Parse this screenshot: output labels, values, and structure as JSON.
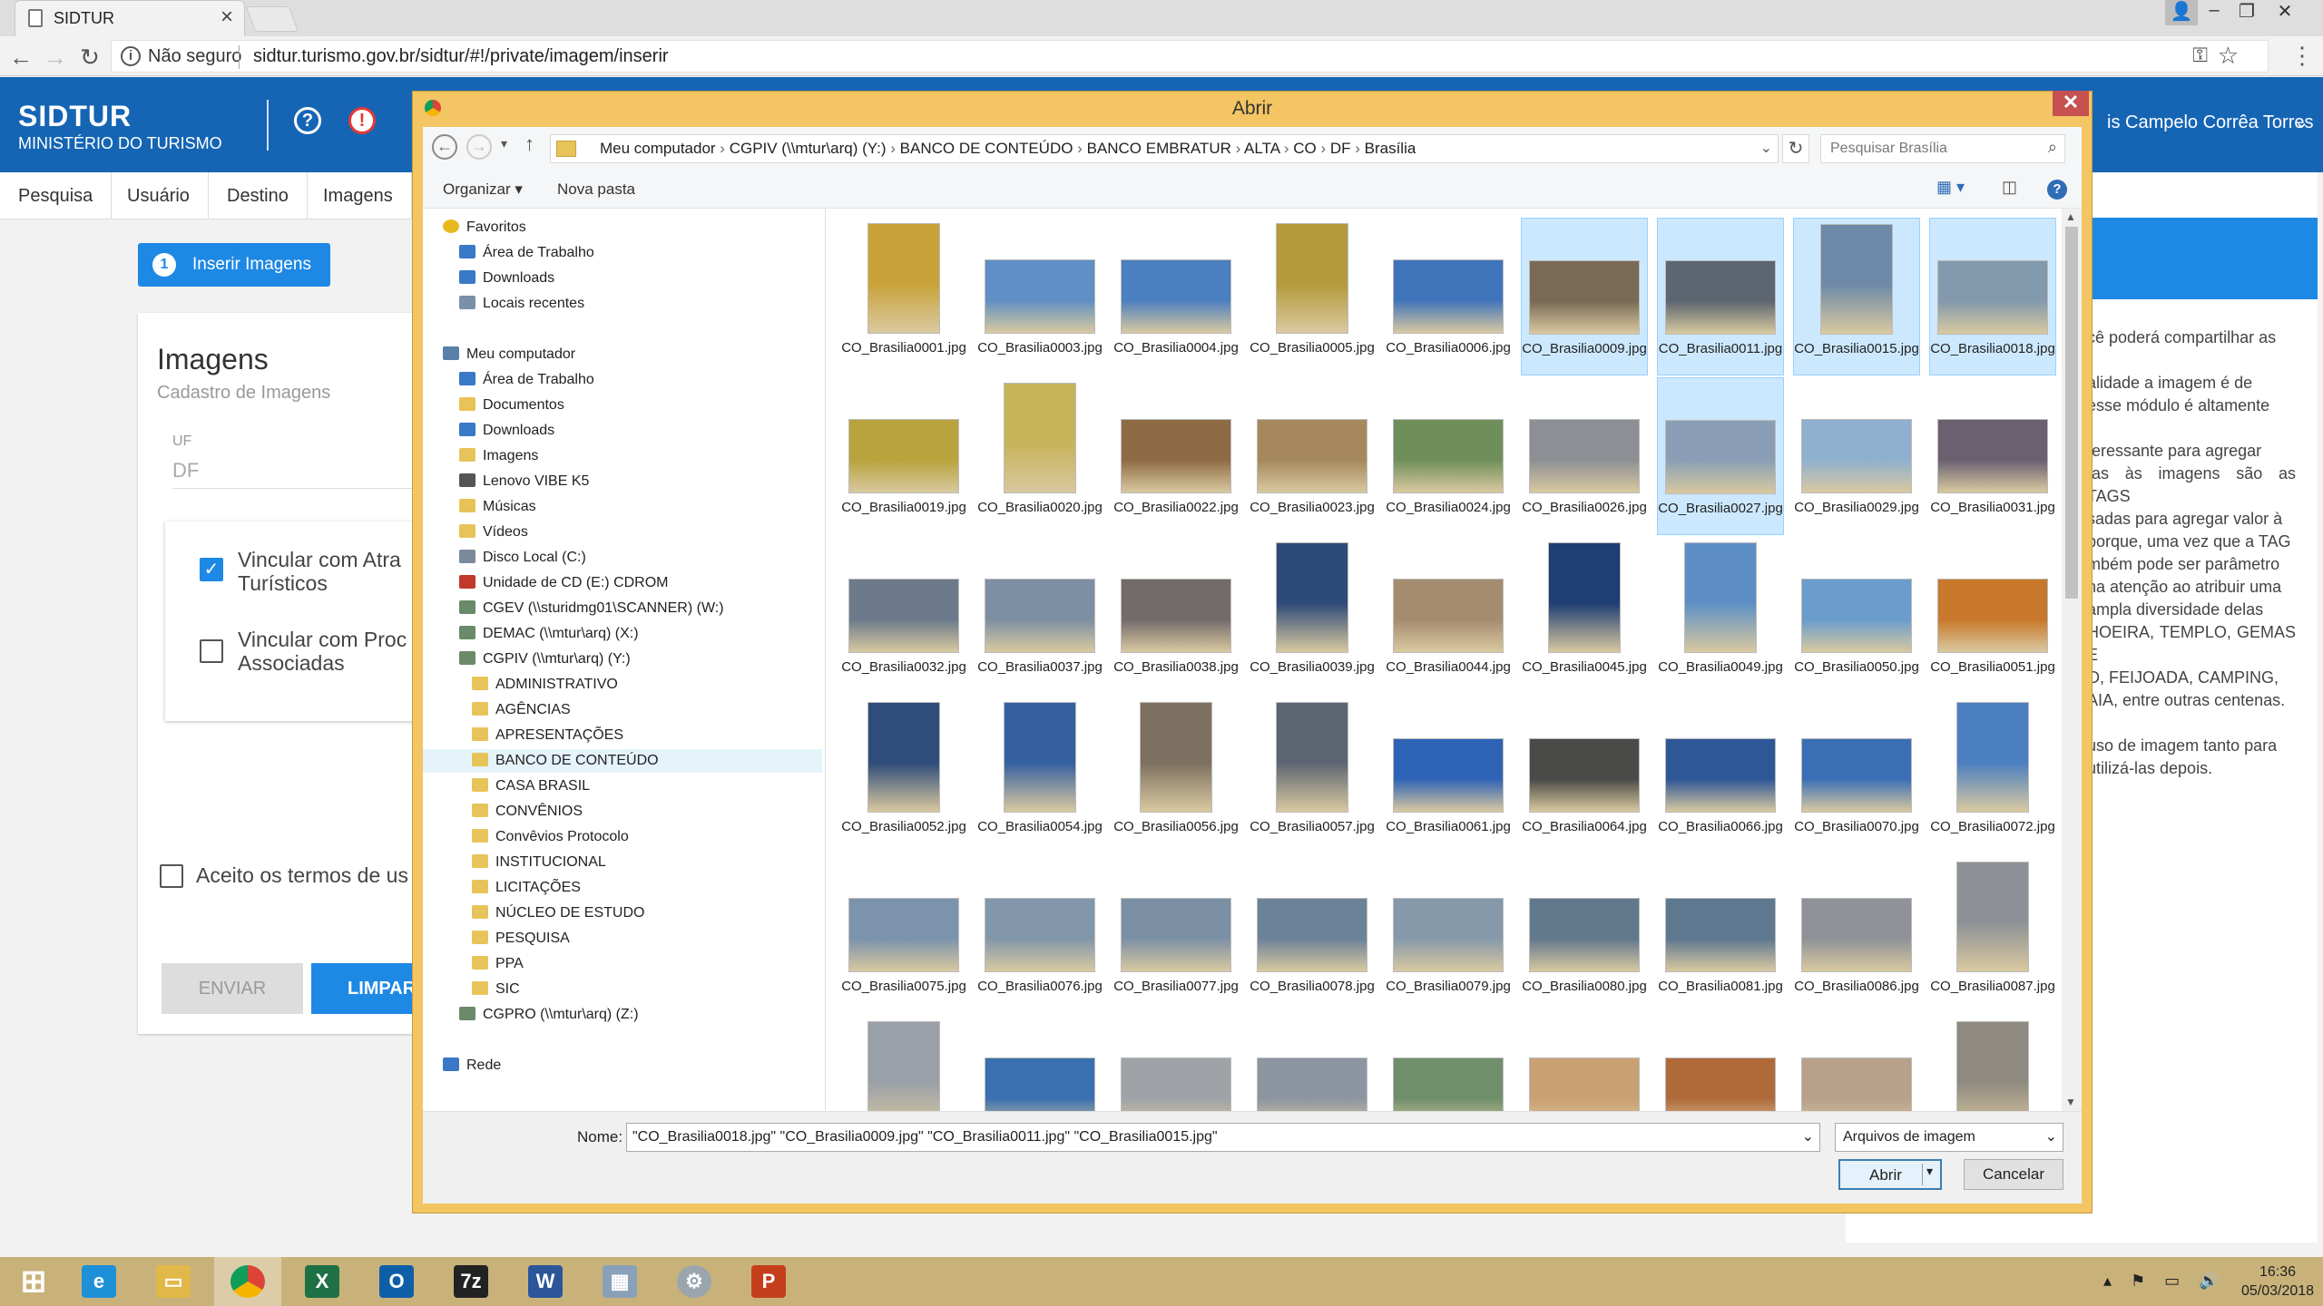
{
  "browser": {
    "tab_title": "SIDTUR",
    "not_secure": "Não seguro",
    "url": "sidtur.turismo.gov.br/sidtur/#!/private/imagem/inserir"
  },
  "app": {
    "brand": "SIDTUR",
    "brand_sub": "MINISTÉRIO DO TURISMO",
    "user_name": "is Campelo Corrêa Torres",
    "nav": [
      "Pesquisa",
      "Usuário",
      "Destino",
      "Imagens"
    ],
    "insert_button": "Inserir Imagens",
    "step": "1",
    "card_title": "Imagens",
    "card_subtitle": "Cadastro de Imagens",
    "uf_label": "UF",
    "uf_value": "DF",
    "check1_line1": "Vincular com Atra",
    "check1_line2": "Turísticos",
    "check2_line1": "Vincular com Proc",
    "check2_line2": "Associadas",
    "terms": "Aceito os termos de us",
    "btn_send": "ENVIAR",
    "btn_clear": "LIMPAR",
    "right_text": [
      "cê poderá compartilhar as",
      "",
      "alidade a imagem é de",
      "esse módulo é altamente",
      "",
      "teressante para agregar",
      "tas às imagens são as TAGS",
      "sadas para agregar valor à",
      "porque, uma vez que a TAG",
      "mbém pode ser parâmetro",
      "ha atenção ao atribuir uma",
      "ampla diversidade delas",
      "HOEIRA, TEMPLO, GEMAS E",
      "O, FEIJOADA, CAMPING,",
      "AIA, entre outras centenas.",
      "",
      "uso de imagem tanto para",
      "utilizá-las depois."
    ]
  },
  "dialog": {
    "title": "Abrir",
    "path": [
      "Meu computador",
      "CGPIV (\\\\mtur\\arq) (Y:)",
      "BANCO DE CONTEÚDO",
      "BANCO EMBRATUR",
      "ALTA",
      "CO",
      "DF",
      "Brasília"
    ],
    "search_placeholder": "Pesquisar Brasília",
    "organize": "Organizar",
    "new_folder": "Nova pasta",
    "tree": [
      {
        "label": "Favoritos",
        "level": 0,
        "icon": "star"
      },
      {
        "label": "Área de Trabalho",
        "level": 1,
        "icon": "desktop"
      },
      {
        "label": "Downloads",
        "level": 1,
        "icon": "download"
      },
      {
        "label": "Locais recentes",
        "level": 1,
        "icon": "recent"
      },
      {
        "label": "",
        "level": -1
      },
      {
        "label": "Meu computador",
        "level": 0,
        "icon": "computer"
      },
      {
        "label": "Área de Trabalho",
        "level": 1,
        "icon": "desktop"
      },
      {
        "label": "Documentos",
        "level": 1,
        "icon": "folder"
      },
      {
        "label": "Downloads",
        "level": 1,
        "icon": "download"
      },
      {
        "label": "Imagens",
        "level": 1,
        "icon": "folder"
      },
      {
        "label": "Lenovo VIBE K5",
        "level": 1,
        "icon": "phone"
      },
      {
        "label": "Músicas",
        "level": 1,
        "icon": "folder"
      },
      {
        "label": "Vídeos",
        "level": 1,
        "icon": "folder"
      },
      {
        "label": "Disco Local (C:)",
        "level": 1,
        "icon": "drive"
      },
      {
        "label": "Unidade de CD (E:) CDROM",
        "level": 1,
        "icon": "cd"
      },
      {
        "label": "CGEV (\\\\sturidmg01\\SCANNER) (W:)",
        "level": 1,
        "icon": "netdrive"
      },
      {
        "label": "DEMAC (\\\\mtur\\arq) (X:)",
        "level": 1,
        "icon": "netdrive"
      },
      {
        "label": "CGPIV (\\\\mtur\\arq) (Y:)",
        "level": 1,
        "icon": "netdrive"
      },
      {
        "label": "ADMINISTRATIVO",
        "level": 2,
        "icon": "folder"
      },
      {
        "label": "AGÊNCIAS",
        "level": 2,
        "icon": "folder"
      },
      {
        "label": "APRESENTAÇÕES",
        "level": 2,
        "icon": "folder"
      },
      {
        "label": "BANCO DE CONTEÚDO",
        "level": 2,
        "icon": "folder",
        "selected": true
      },
      {
        "label": "CASA BRASIL",
        "level": 2,
        "icon": "folder"
      },
      {
        "label": "CONVÊNIOS",
        "level": 2,
        "icon": "folder"
      },
      {
        "label": "Convêvios Protocolo",
        "level": 2,
        "icon": "folder"
      },
      {
        "label": "INSTITUCIONAL",
        "level": 2,
        "icon": "folder"
      },
      {
        "label": "LICITAÇÕES",
        "level": 2,
        "icon": "folder"
      },
      {
        "label": "NÚCLEO DE ESTUDO",
        "level": 2,
        "icon": "folder"
      },
      {
        "label": "PESQUISA",
        "level": 2,
        "icon": "folder"
      },
      {
        "label": "PPA",
        "level": 2,
        "icon": "folder"
      },
      {
        "label": "SIC",
        "level": 2,
        "icon": "folder"
      },
      {
        "label": "CGPRO (\\\\mtur\\arq) (Z:)",
        "level": 1,
        "icon": "netdrive"
      },
      {
        "label": "",
        "level": -1
      },
      {
        "label": "Rede",
        "level": 0,
        "icon": "network"
      }
    ],
    "files": [
      {
        "name": "CO_Brasilia0001.jpg",
        "o": "p",
        "c": "#c9a33a"
      },
      {
        "name": "CO_Brasilia0003.jpg",
        "o": "l",
        "c": "#5f8fc4"
      },
      {
        "name": "CO_Brasilia0004.jpg",
        "o": "l",
        "c": "#4a7fc0"
      },
      {
        "name": "CO_Brasilia0005.jpg",
        "o": "p",
        "c": "#b49a3b"
      },
      {
        "name": "CO_Brasilia0006.jpg",
        "o": "l",
        "c": "#3f74bb"
      },
      {
        "name": "CO_Brasilia0009.jpg",
        "o": "l",
        "c": "#7a6a55",
        "sel": true
      },
      {
        "name": "CO_Brasilia0011.jpg",
        "o": "l",
        "c": "#5d6670",
        "sel": true
      },
      {
        "name": "CO_Brasilia0015.jpg",
        "o": "p",
        "c": "#6e8aa8",
        "sel": true
      },
      {
        "name": "CO_Brasilia0018.jpg",
        "o": "l",
        "c": "#8399ad",
        "sel": true
      },
      {
        "name": "CO_Brasilia0019.jpg",
        "o": "l",
        "c": "#b8a33c"
      },
      {
        "name": "CO_Brasilia0020.jpg",
        "o": "p",
        "c": "#c7b35a"
      },
      {
        "name": "CO_Brasilia0022.jpg",
        "o": "l",
        "c": "#8d6b45"
      },
      {
        "name": "CO_Brasilia0023.jpg",
        "o": "l",
        "c": "#a5895c"
      },
      {
        "name": "CO_Brasilia0024.jpg",
        "o": "l",
        "c": "#6f8f5a"
      },
      {
        "name": "CO_Brasilia0026.jpg",
        "o": "l",
        "c": "#8c8f94"
      },
      {
        "name": "CO_Brasilia0027.jpg",
        "o": "l",
        "c": "#8a9fb5",
        "hov": true
      },
      {
        "name": "CO_Brasilia0029.jpg",
        "o": "l",
        "c": "#8fb0cf"
      },
      {
        "name": "CO_Brasilia0031.jpg",
        "o": "l",
        "c": "#6a6070"
      },
      {
        "name": "CO_Brasilia0032.jpg",
        "o": "l",
        "c": "#6c7a8c"
      },
      {
        "name": "CO_Brasilia0037.jpg",
        "o": "l",
        "c": "#7d8fa2"
      },
      {
        "name": "CO_Brasilia0038.jpg",
        "o": "l",
        "c": "#736a6a"
      },
      {
        "name": "CO_Brasilia0039.jpg",
        "o": "p",
        "c": "#2e4a78"
      },
      {
        "name": "CO_Brasilia0044.jpg",
        "o": "l",
        "c": "#a58b70"
      },
      {
        "name": "CO_Brasilia0045.jpg",
        "o": "p",
        "c": "#1f3e74"
      },
      {
        "name": "CO_Brasilia0049.jpg",
        "o": "p",
        "c": "#5d8fc6"
      },
      {
        "name": "CO_Brasilia0050.jpg",
        "o": "l",
        "c": "#6a9ccc"
      },
      {
        "name": "CO_Brasilia0051.jpg",
        "o": "l",
        "c": "#c8782a"
      },
      {
        "name": "CO_Brasilia0052.jpg",
        "o": "p",
        "c": "#2f4d7a"
      },
      {
        "name": "CO_Brasilia0054.jpg",
        "o": "p",
        "c": "#3560a0"
      },
      {
        "name": "CO_Brasilia0056.jpg",
        "o": "p",
        "c": "#7d7060"
      },
      {
        "name": "CO_Brasilia0057.jpg",
        "o": "p",
        "c": "#5d6572"
      },
      {
        "name": "CO_Brasilia0061.jpg",
        "o": "l",
        "c": "#2f63b5"
      },
      {
        "name": "CO_Brasilia0064.jpg",
        "o": "l",
        "c": "#4a4a48"
      },
      {
        "name": "CO_Brasilia0066.jpg",
        "o": "l",
        "c": "#2d5796"
      },
      {
        "name": "CO_Brasilia0070.jpg",
        "o": "l",
        "c": "#3b6fb5"
      },
      {
        "name": "CO_Brasilia0072.jpg",
        "o": "p",
        "c": "#4c7fc0"
      },
      {
        "name": "CO_Brasilia0075.jpg",
        "o": "l",
        "c": "#7b93ac"
      },
      {
        "name": "CO_Brasilia0076.jpg",
        "o": "l",
        "c": "#8297aa"
      },
      {
        "name": "CO_Brasilia0077.jpg",
        "o": "l",
        "c": "#7c90a5"
      },
      {
        "name": "CO_Brasilia0078.jpg",
        "o": "l",
        "c": "#6c8298"
      },
      {
        "name": "CO_Brasilia0079.jpg",
        "o": "l",
        "c": "#8699ab"
      },
      {
        "name": "CO_Brasilia0080.jpg",
        "o": "l",
        "c": "#62788c"
      },
      {
        "name": "CO_Brasilia0081.jpg",
        "o": "l",
        "c": "#5e7890"
      },
      {
        "name": "CO_Brasilia0086.jpg",
        "o": "l",
        "c": "#8f9298"
      },
      {
        "name": "CO_Brasilia0087.jpg",
        "o": "p",
        "c": "#8d9096"
      },
      {
        "name": "",
        "o": "p",
        "c": "#9aa0a8"
      },
      {
        "name": "",
        "o": "l",
        "c": "#3a6fb0"
      },
      {
        "name": "",
        "o": "l",
        "c": "#9fa3a8"
      },
      {
        "name": "",
        "o": "l",
        "c": "#8d96a0"
      },
      {
        "name": "",
        "o": "l",
        "c": "#6f8f6a"
      },
      {
        "name": "",
        "o": "l",
        "c": "#c9a072"
      },
      {
        "name": "",
        "o": "l",
        "c": "#b06a3a"
      },
      {
        "name": "",
        "o": "l",
        "c": "#b8a08a"
      },
      {
        "name": "",
        "o": "p",
        "c": "#8f8a80"
      }
    ],
    "filename_label": "Nome:",
    "filename_value": "\"CO_Brasilia0018.jpg\" \"CO_Brasilia0009.jpg\" \"CO_Brasilia0011.jpg\" \"CO_Brasilia0015.jpg\"",
    "filter": "Arquivos de imagem",
    "open": "Abrir",
    "cancel": "Cancelar"
  },
  "taskbar": {
    "time": "16:36",
    "date": "05/03/2018"
  }
}
